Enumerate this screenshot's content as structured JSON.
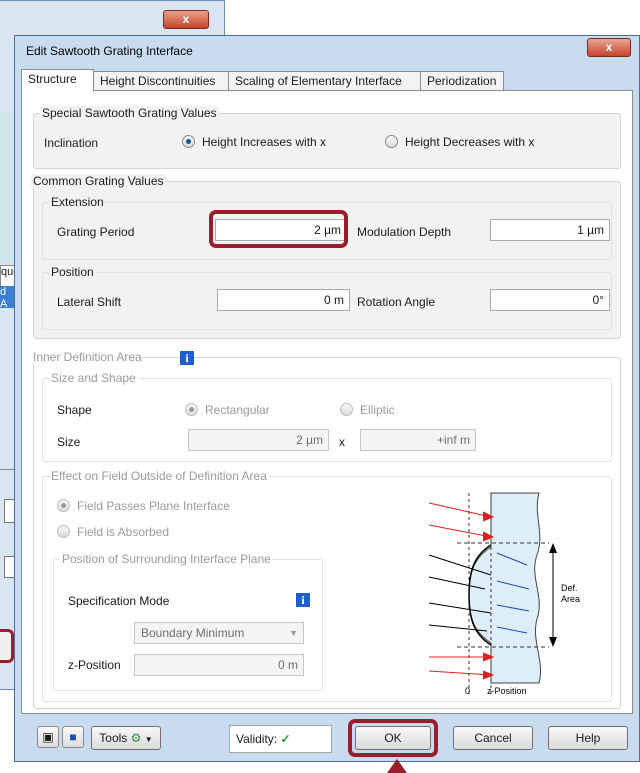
{
  "background_window": {
    "close_label": "x",
    "tab1_text": "que",
    "tab2_text": "d A"
  },
  "dialog": {
    "title": "Edit Sawtooth Grating Interface",
    "close_label": "x",
    "tabs": [
      {
        "label": "Structure",
        "active": true
      },
      {
        "label": "Height Discontinuities",
        "active": false
      },
      {
        "label": "Scaling of Elementary Interface",
        "active": false
      },
      {
        "label": "Periodization",
        "active": false
      }
    ]
  },
  "special": {
    "title": "Special Sawtooth Grating Values",
    "inclination_label": "Inclination",
    "option_increase": "Height Increases with x",
    "option_decrease": "Height Decreases with x",
    "selected": "increase"
  },
  "common": {
    "title": "Common Grating Values",
    "extension_title": "Extension",
    "grating_period_label": "Grating Period",
    "grating_period_value": "2 µm",
    "modulation_depth_label": "Modulation Depth",
    "modulation_depth_value": "1 µm",
    "position_title": "Position",
    "lateral_shift_label": "Lateral Shift",
    "lateral_shift_value": "0 m",
    "rotation_angle_label": "Rotation Angle",
    "rotation_angle_value": "0°"
  },
  "inner": {
    "title": "Inner Definition Area",
    "size_shape_title": "Size and Shape",
    "shape_label": "Shape",
    "shape_rect": "Rectangular",
    "shape_elliptic": "Elliptic",
    "size_label": "Size",
    "size_x_value": "2 µm",
    "size_times": "x",
    "size_y_value": "+inf m",
    "effect_title": "Effect on Field Outside of Definition Area",
    "field_passes": "Field Passes Plane Interface",
    "field_absorbed": "Field is Absorbed",
    "surrounding_title": "Position of Surrounding Interface Plane",
    "spec_mode_label": "Specification Mode",
    "spec_mode_value": "Boundary Minimum",
    "z_position_label": "z-Position",
    "z_position_value": "0 m",
    "diagram": {
      "def_area_label": "Def.",
      "def_area_label2": "Area",
      "zero_label": "0",
      "zpos_label": "z-Position"
    }
  },
  "bottom": {
    "tools_label": "Tools",
    "validity_label": "Validity:",
    "validity_mark": "✓",
    "ok_label": "OK",
    "cancel_label": "Cancel",
    "help_label": "Help"
  },
  "colors": {
    "highlight": "#9b1c2c",
    "info": "#1f5fc9",
    "valid": "#1f9d2b"
  }
}
